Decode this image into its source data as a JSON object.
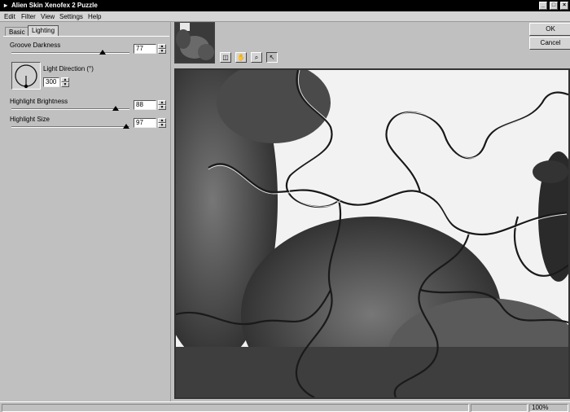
{
  "window": {
    "title": "Alien Skin Xenofex 2 Puzzle",
    "sys_glyph": "▸",
    "min_glyph": "_",
    "max_glyph": "□",
    "close_glyph": "×"
  },
  "menu": [
    "Edit",
    "Filter",
    "View",
    "Settings",
    "Help"
  ],
  "tabs": [
    {
      "label": "Basic",
      "active": false
    },
    {
      "label": "Lighting",
      "active": true
    }
  ],
  "controls": {
    "groove_darkness": {
      "label": "Groove Darkness",
      "value": "77",
      "fraction": 0.77
    },
    "light_direction": {
      "label": "Light Direction (°)",
      "value": "300",
      "degrees": 300
    },
    "highlight_brightness": {
      "label": "Highlight Brightness",
      "value": "88",
      "fraction": 0.88
    },
    "highlight_size": {
      "label": "Highlight Size",
      "value": "97",
      "fraction": 0.97
    }
  },
  "spin": {
    "up": "▲",
    "down": "▼"
  },
  "toolbar": {
    "tools": [
      {
        "name": "preview-toggle-icon",
        "glyph": "◫",
        "active": false
      },
      {
        "name": "hand-icon",
        "glyph": "✋",
        "active": false
      },
      {
        "name": "zoom-icon",
        "glyph": "⌕",
        "active": false
      },
      {
        "name": "arrow-pointer-icon",
        "glyph": "↖",
        "active": true
      }
    ]
  },
  "buttons": {
    "ok": "OK",
    "cancel": "Cancel"
  },
  "status": {
    "zoom": "100%"
  }
}
